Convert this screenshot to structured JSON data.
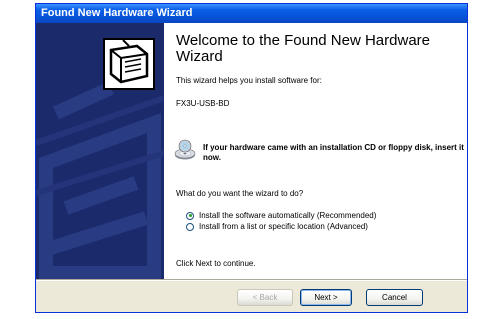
{
  "window": {
    "title": "Found New Hardware Wizard"
  },
  "content": {
    "heading": "Welcome to the Found New Hardware Wizard",
    "intro": "This wizard helps you install software for:",
    "device_name": "FX3U-USB-BD",
    "cd_note": "If your hardware came with an installation CD or floppy disk, insert it now.",
    "question": "What do you want the wizard to do?",
    "options": [
      {
        "label": "Install the software automatically (Recommended)",
        "selected": true
      },
      {
        "label": "Install from a list or specific location (Advanced)",
        "selected": false
      }
    ],
    "footer_note": "Click Next to continue."
  },
  "buttons": {
    "back": "< Back",
    "next": "Next >",
    "cancel": "Cancel"
  },
  "colors": {
    "titlebar": "#0552d6",
    "sidebar": "#1b2a6b",
    "dialog_face": "#ece9d8"
  },
  "icons": {
    "sidebar": "hardware-card-icon",
    "cd": "cd-disk-icon"
  }
}
